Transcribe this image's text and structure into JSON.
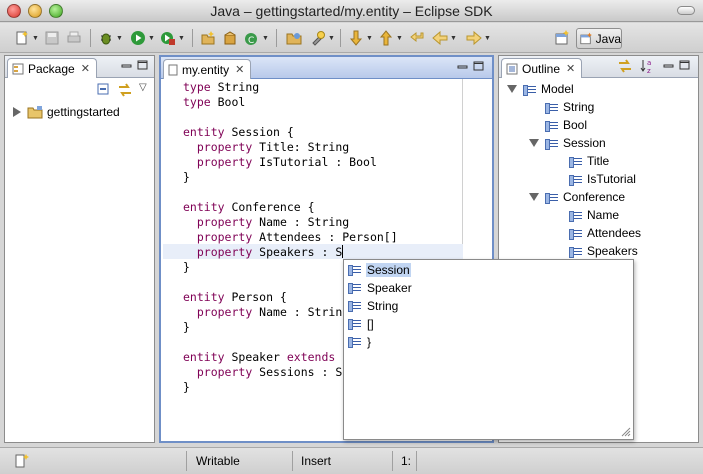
{
  "window": {
    "title": "Java – gettingstarted/my.entity – Eclipse SDK"
  },
  "toolbar": {
    "perspective_label": "Java"
  },
  "package_view": {
    "tab_label": "Package",
    "items": [
      {
        "label": "gettingstarted"
      }
    ]
  },
  "editor": {
    "tab_label": "my.entity",
    "lines": [
      [
        {
          "t": "type",
          "k": 1
        },
        {
          "t": " String"
        }
      ],
      [
        {
          "t": "type",
          "k": 1
        },
        {
          "t": " Bool"
        }
      ],
      [],
      [
        {
          "t": "entity",
          "k": 1
        },
        {
          "t": " Session {"
        }
      ],
      [
        {
          "t": "  "
        },
        {
          "t": "property",
          "k": 1
        },
        {
          "t": " Title: String"
        }
      ],
      [
        {
          "t": "  "
        },
        {
          "t": "property",
          "k": 1
        },
        {
          "t": " IsTutorial : Bool"
        }
      ],
      [
        {
          "t": "}"
        }
      ],
      [],
      [
        {
          "t": "entity",
          "k": 1
        },
        {
          "t": " Conference {"
        }
      ],
      [
        {
          "t": "  "
        },
        {
          "t": "property",
          "k": 1
        },
        {
          "t": " Name : String"
        }
      ],
      [
        {
          "t": "  "
        },
        {
          "t": "property",
          "k": 1
        },
        {
          "t": " Attendees : Person[]"
        }
      ],
      [
        {
          "t": "  "
        },
        {
          "t": "property",
          "k": 1
        },
        {
          "t": " Speakers : S"
        }
      ],
      [
        {
          "t": "}"
        }
      ],
      [],
      [
        {
          "t": "entity",
          "k": 1
        },
        {
          "t": " Person {"
        }
      ],
      [
        {
          "t": "  "
        },
        {
          "t": "property",
          "k": 1
        },
        {
          "t": " Name : Strin"
        }
      ],
      [
        {
          "t": "}"
        }
      ],
      [],
      [
        {
          "t": "entity",
          "k": 1
        },
        {
          "t": " Speaker "
        },
        {
          "t": "extends",
          "k": 1
        }
      ],
      [
        {
          "t": "  "
        },
        {
          "t": "property",
          "k": 1
        },
        {
          "t": " Sessions : S"
        }
      ],
      [
        {
          "t": "}"
        }
      ]
    ]
  },
  "outline_view": {
    "tab_label": "Outline",
    "tree": [
      {
        "label": "Model",
        "level": 0,
        "expanded": true
      },
      {
        "label": "String",
        "level": 1
      },
      {
        "label": "Bool",
        "level": 1
      },
      {
        "label": "Session",
        "level": 1,
        "expanded": true
      },
      {
        "label": "Title",
        "level": 2
      },
      {
        "label": "IsTutorial",
        "level": 2
      },
      {
        "label": "Conference",
        "level": 1,
        "expanded": true
      },
      {
        "label": "Name",
        "level": 2
      },
      {
        "label": "Attendees",
        "level": 2
      },
      {
        "label": "Speakers",
        "level": 2
      }
    ]
  },
  "content_assist": {
    "items": [
      {
        "label": "Session",
        "selected": true
      },
      {
        "label": "Speaker"
      },
      {
        "label": "String"
      },
      {
        "label": "[]"
      },
      {
        "label": "}"
      }
    ]
  },
  "statusbar": {
    "writable": "Writable",
    "insert_mode": "Insert",
    "position": "1:"
  },
  "colors": {
    "keyword": "#7f0055",
    "selection": "#c1d5f2",
    "active_border": "#6f8fc7"
  }
}
